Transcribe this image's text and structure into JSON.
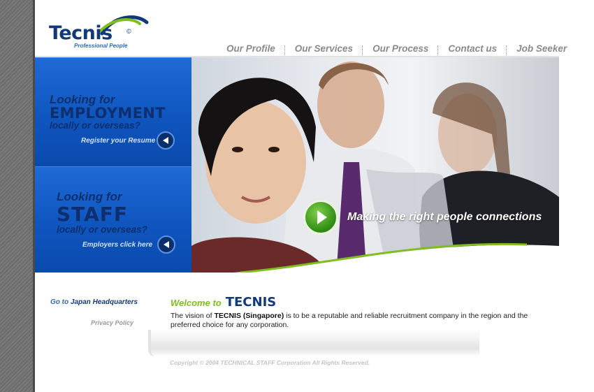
{
  "brand": {
    "name": "Tecnis",
    "copyright_mark": "©",
    "tagline": "Professional People"
  },
  "nav": {
    "items": [
      {
        "label": "Our Profile"
      },
      {
        "label": "Our Services"
      },
      {
        "label": "Our Process"
      },
      {
        "label": "Contact us"
      },
      {
        "label": "Job Seeker"
      }
    ]
  },
  "panels": {
    "employment": {
      "line1": "Looking for",
      "line2": "EMPLOYMENT",
      "line3": "locally or overseas?",
      "link": "Register your Resume"
    },
    "staff": {
      "line1": "Looking for",
      "line2": "STAFF",
      "line3": "locally or overseas?",
      "link": "Employers click here"
    }
  },
  "hero": {
    "caption": "Making the right people connections"
  },
  "sidebar": {
    "hq_prefix": "Go to",
    "hq_label": "Japan Headquarters",
    "privacy": "Privacy Policy"
  },
  "welcome": {
    "prefix": "Welcome to",
    "brand": "TECNIS"
  },
  "vision": {
    "lead": "The vision of ",
    "entity": "TECNIS (Singapore)",
    "rest": " is to be a reputable and reliable recruitment company in the region and the preferred choice for any corporation."
  },
  "footer": {
    "copyright": "Copyright © 2004 TECHNICAL STAFF Corporation All Rights Reserved."
  },
  "colors": {
    "brand_navy": "#123a7a",
    "panel_blue": "#1360cc",
    "accent_green": "#7fbe1e"
  }
}
